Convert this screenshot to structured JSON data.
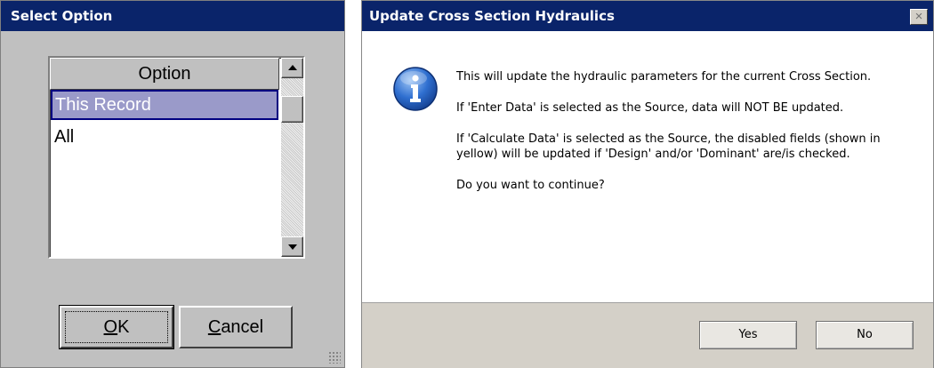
{
  "select_option": {
    "title": "Select Option",
    "column_header": "Option",
    "rows": [
      {
        "label": "This Record",
        "selected": true
      },
      {
        "label": "All",
        "selected": false
      }
    ],
    "ok_label_accel": "O",
    "ok_label_rest": "K",
    "cancel_label_accel": "C",
    "cancel_label_rest": "ancel"
  },
  "update_dialog": {
    "title": "Update Cross Section Hydraulics",
    "close_glyph": "×",
    "icon": "info-icon",
    "messages": [
      "This will update the hydraulic parameters for the current Cross Section.",
      "If 'Enter Data' is selected as the Source, data will NOT BE updated.",
      "If 'Calculate Data' is selected as the Source, the disabled fields (shown in yellow) will be updated if 'Design' and/or 'Dominant' are/is checked.",
      "Do you want to continue?"
    ],
    "yes_label": "Yes",
    "no_label": "No"
  },
  "colors": {
    "titlebar": "#0a246a",
    "selection": "#9a9ac9",
    "dialog_face": "#c0c0c0",
    "footer": "#d4d0c8"
  }
}
